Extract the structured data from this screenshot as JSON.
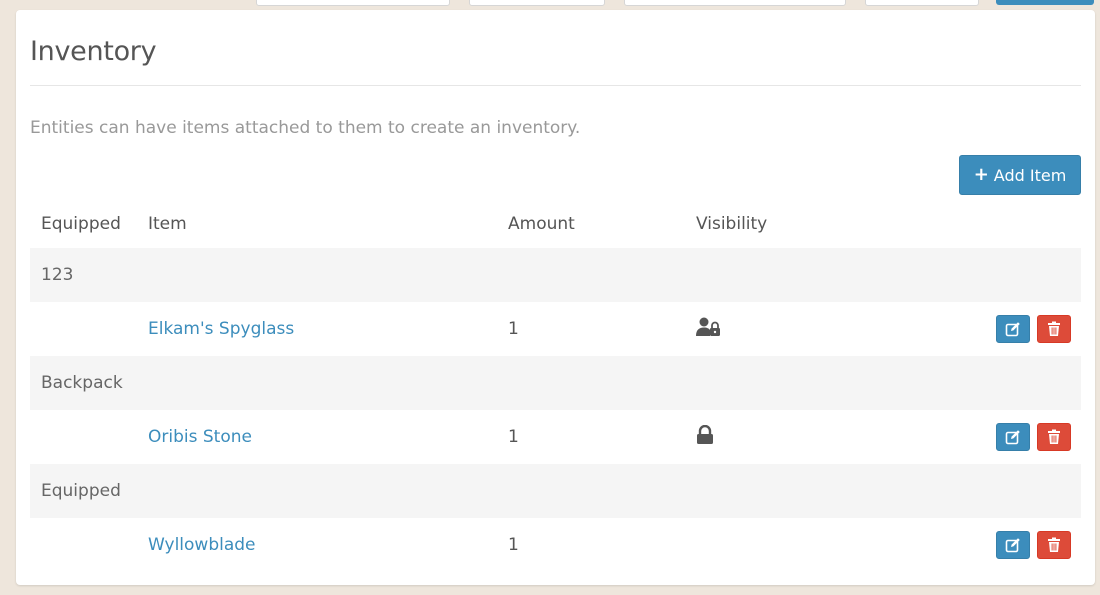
{
  "panel": {
    "title": "Inventory",
    "help_text": "Entities can have items attached to them to create an inventory.",
    "add_button_label": "Add Item"
  },
  "table": {
    "headers": [
      "Equipped",
      "Item",
      "Amount",
      "Visibility"
    ],
    "groups": [
      {
        "label": "123",
        "items": [
          {
            "name": "Elkam's Spyglass",
            "amount": "1",
            "visibility_icon": "user-lock-icon"
          }
        ]
      },
      {
        "label": "Backpack",
        "items": [
          {
            "name": "Oribis Stone",
            "amount": "1",
            "visibility_icon": "lock-icon"
          }
        ]
      },
      {
        "label": "Equipped",
        "items": [
          {
            "name": "Wyllowblade",
            "amount": "1",
            "visibility_icon": ""
          }
        ]
      }
    ]
  },
  "colors": {
    "primary": "#3c8dbc",
    "danger": "#dd4b39",
    "group_row_bg": "#f5f5f5",
    "page_bg": "#eee6dc"
  }
}
